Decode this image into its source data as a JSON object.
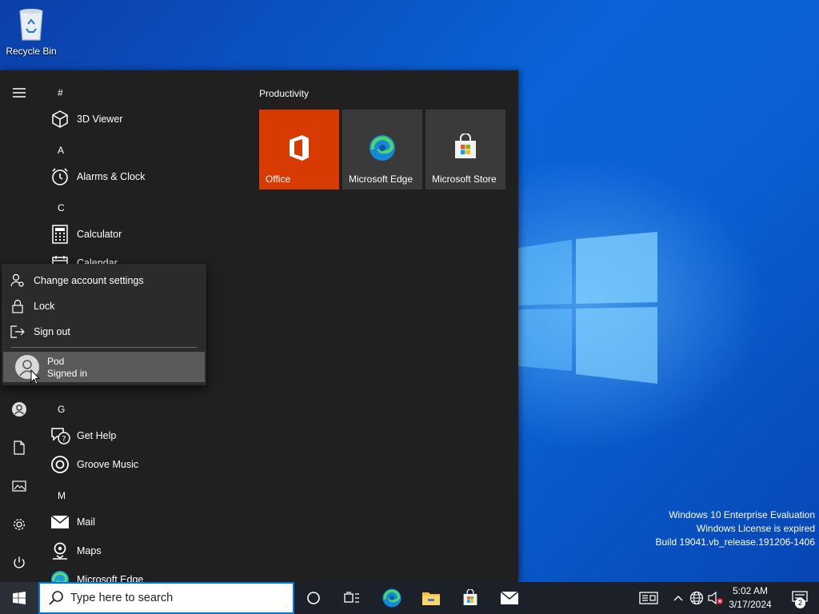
{
  "desktop": {
    "recycle_bin_label": "Recycle Bin",
    "watermark": {
      "line1": "Windows 10 Enterprise Evaluation",
      "line2": "Windows License is expired",
      "line3": "Build 19041.vb_release.191206-1406"
    }
  },
  "start_menu": {
    "app_list": {
      "letters": [
        "#",
        "A",
        "C",
        "G",
        "M"
      ],
      "apps": [
        {
          "name": "3D Viewer",
          "icon": "cube-icon"
        },
        {
          "name": "Alarms & Clock",
          "icon": "alarm-clock-icon"
        },
        {
          "name": "Calculator",
          "icon": "calculator-icon"
        },
        {
          "name": "Calendar",
          "icon": "calendar-icon"
        },
        {
          "name": "Get Help",
          "icon": "help-icon"
        },
        {
          "name": "Groove Music",
          "icon": "music-icon"
        },
        {
          "name": "Mail",
          "icon": "mail-icon"
        },
        {
          "name": "Maps",
          "icon": "maps-icon"
        },
        {
          "name": "Microsoft Edge",
          "icon": "edge-icon"
        }
      ]
    },
    "tiles": {
      "group_header": "Productivity",
      "items": [
        {
          "label": "Office",
          "icon": "office-icon",
          "color": "#d83b01"
        },
        {
          "label": "Microsoft Edge",
          "icon": "edge-icon",
          "color": "#3a3a3a"
        },
        {
          "label": "Microsoft Store",
          "icon": "store-icon",
          "color": "#3a3a3a"
        }
      ]
    },
    "account_flyout": {
      "change_settings": "Change account settings",
      "lock": "Lock",
      "sign_out": "Sign out",
      "user_name": "Pod",
      "user_status": "Signed in"
    }
  },
  "taskbar": {
    "search_placeholder": "Type here to search",
    "time": "5:02 AM",
    "date": "3/17/2024",
    "notification_count": "2",
    "accent_color": "#0078d7"
  }
}
